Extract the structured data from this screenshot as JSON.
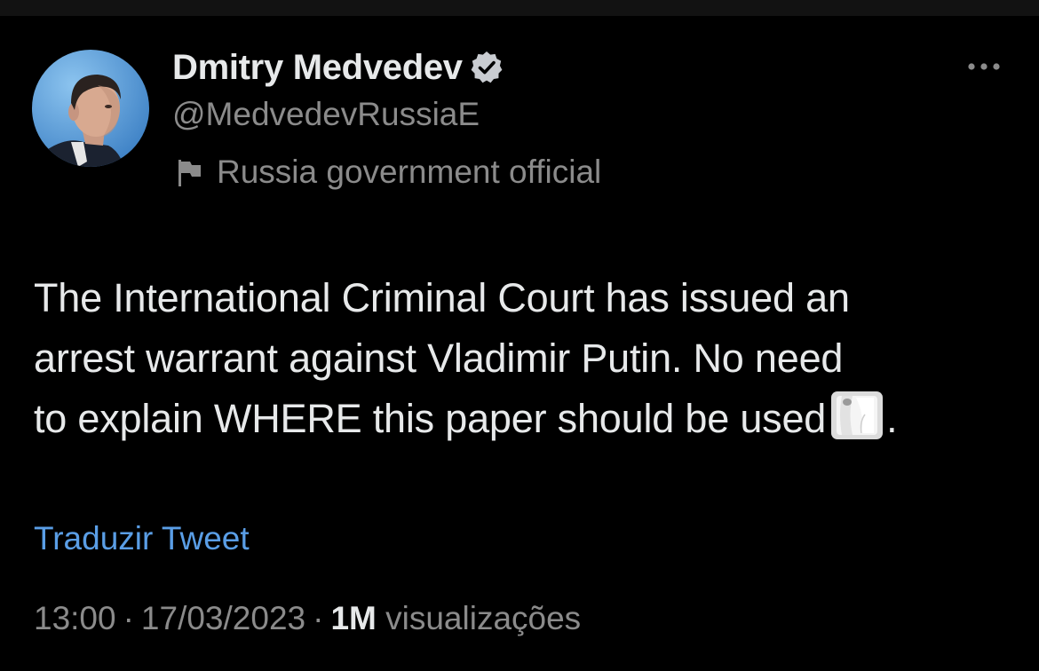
{
  "author": {
    "display_name": "Dmitry Medvedev",
    "handle": "@MedvedevRussiaE",
    "verified": true,
    "affiliation": "Russia government official",
    "avatar": "profile-photo"
  },
  "tweet": {
    "text_lines": [
      "The International Criminal Court has issued an",
      "arrest warrant against Vladimir Putin. No need",
      "to explain WHERE this paper should be used"
    ],
    "text_end": ".",
    "emoji": "toilet-paper-icon"
  },
  "translate_label": "Traduzir Tweet",
  "meta": {
    "time": "13:00",
    "separator": "·",
    "date": "17/03/2023",
    "views_count": "1M",
    "views_label": "visualizações"
  },
  "icons": {
    "more": "more-horizontal-icon",
    "verified": "verified-badge-icon",
    "affiliation": "flag-icon"
  },
  "colors": {
    "background": "#000000",
    "text_primary": "#e7e9ea",
    "text_secondary": "#8b8b8b",
    "link": "#5a9ee6"
  }
}
